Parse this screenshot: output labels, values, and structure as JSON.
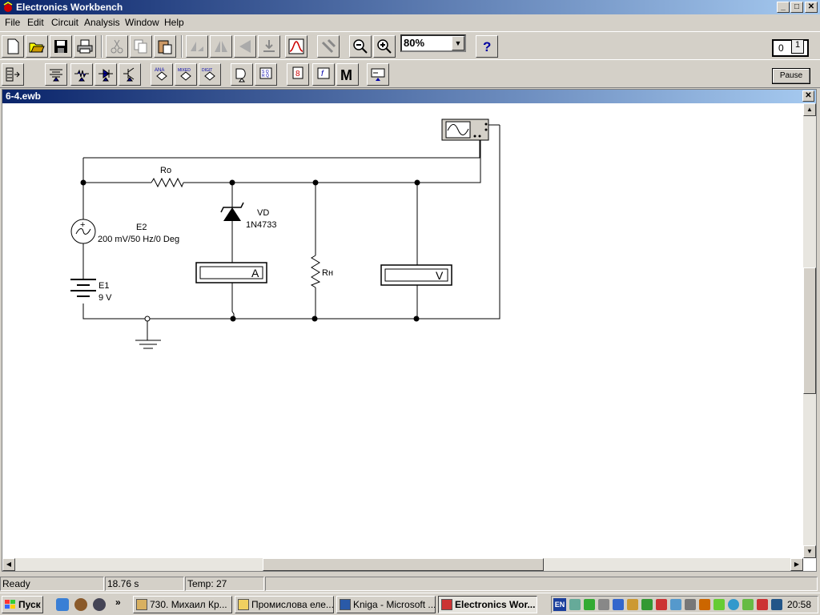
{
  "window": {
    "title": "Electronics Workbench",
    "min": "_",
    "max": "□",
    "close": "✕"
  },
  "menu": [
    "File",
    "Edit",
    "Circuit",
    "Analysis",
    "Window",
    "Help"
  ],
  "toolbar": {
    "zoom": "80%",
    "help": "?"
  },
  "sim": {
    "pause": "Pause",
    "power_off": "0",
    "power_on": "1"
  },
  "document": {
    "title": "6-4.ewb",
    "close": "✕"
  },
  "circuit": {
    "ro": "Ro",
    "e2_name": "E2",
    "e2_value": "200 mV/50 Hz/0 Deg",
    "vd_name": "VD",
    "vd_model": "1N4733",
    "ammeter": "A",
    "rn": "Rн",
    "voltmeter": "V",
    "e1_name": "E1",
    "e1_value": "9 V",
    "plus": "+"
  },
  "status": {
    "state": "Ready",
    "time": "18.76 s",
    "temp": "Temp:  27"
  },
  "taskbar": {
    "start": "Пуск",
    "tasks": [
      "730. Михаил Кр...",
      "Промислова еле...",
      "Kniga - Microsoft ...",
      "Electronics Wor..."
    ],
    "lang": "EN",
    "clock": "20:58"
  },
  "colors": {
    "title_start": "#0a246a",
    "title_end": "#a6caf0",
    "face": "#d4d0c8"
  },
  "icons": [
    "new-icon",
    "open-icon",
    "save-icon",
    "print-icon",
    "cut-icon",
    "copy-icon",
    "paste-icon",
    "rotate-icon",
    "flip-horizontal-icon",
    "flip-vertical-icon",
    "subcircuit-icon",
    "graph-icon",
    "component-properties-icon",
    "zoom-out-icon",
    "zoom-in-icon",
    "help-icon"
  ]
}
